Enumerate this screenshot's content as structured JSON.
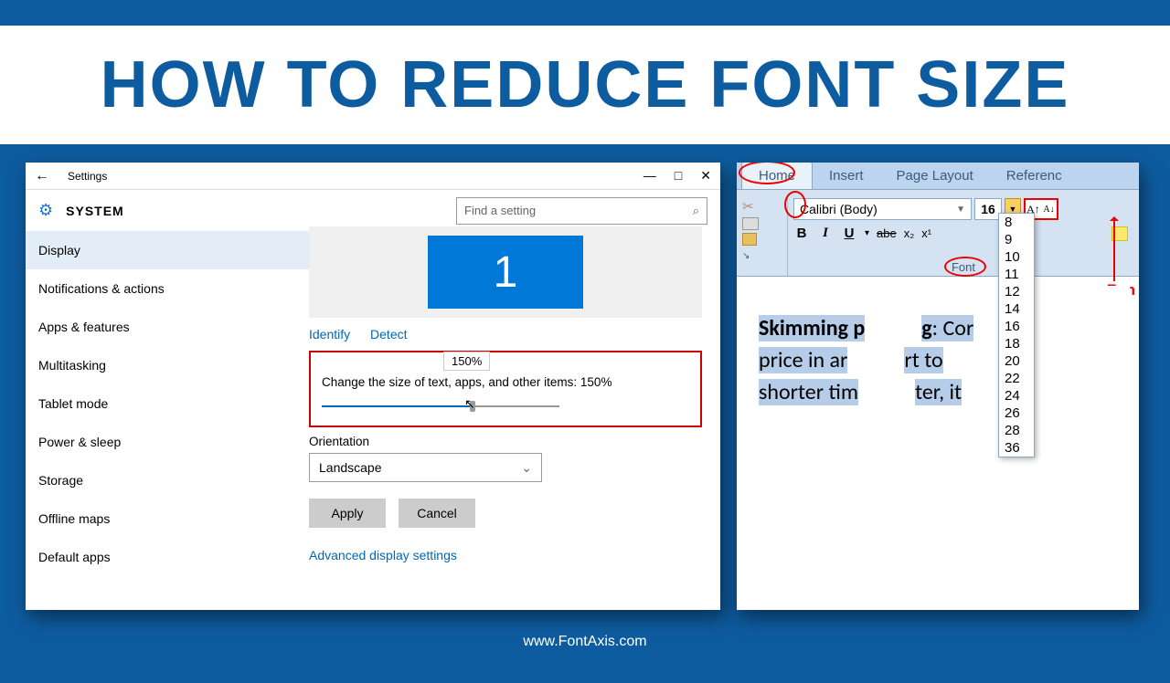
{
  "title": "HOW TO REDUCE FONT SIZE",
  "footer": "www.FontAxis.com",
  "settings": {
    "window_title": "Settings",
    "section": "SYSTEM",
    "search_placeholder": "Find a setting",
    "sidebar": [
      "Display",
      "Notifications & actions",
      "Apps & features",
      "Multitasking",
      "Tablet mode",
      "Power & sleep",
      "Storage",
      "Offline maps",
      "Default apps"
    ],
    "monitor": "1",
    "identify": "Identify",
    "detect": "Detect",
    "scale_tooltip": "150%",
    "scale_text": "Change the size of text, apps, and other items: 150%",
    "orientation_label": "Orientation",
    "orientation_value": "Landscape",
    "apply": "Apply",
    "cancel": "Cancel",
    "advanced": "Advanced display settings"
  },
  "word": {
    "tabs": [
      "Home",
      "Insert",
      "Page Layout",
      "Referenc"
    ],
    "font_name": "Calibri (Body)",
    "font_size": "16",
    "formats": {
      "b": "B",
      "i": "I",
      "u": "U",
      "strike": "abe",
      "sub": "x₂",
      "sup": "x"
    },
    "font_section_label": "Font",
    "size_options": [
      "8",
      "9",
      "10",
      "11",
      "12",
      "14",
      "16",
      "18",
      "20",
      "22",
      "24",
      "26",
      "28",
      "36"
    ],
    "annotation": "Fon",
    "doc": {
      "l1a": "Skimming p",
      "l1b": "g",
      "l1c": ": Cor",
      "l2a": "price in ar",
      "l2b": "rt to",
      "l3a": "shorter tim",
      "l3b": "ter, it"
    }
  }
}
